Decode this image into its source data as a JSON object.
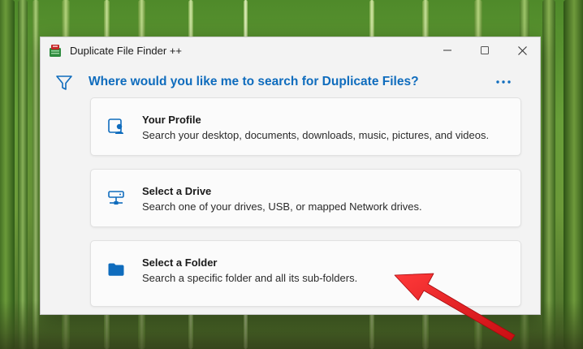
{
  "window": {
    "title": "Duplicate File Finder ++"
  },
  "header": {
    "heading": "Where would you like me to search for Duplicate Files?"
  },
  "options": [
    {
      "title": "Your Profile",
      "description": "Search your desktop, documents, downloads, music, pictures, and videos."
    },
    {
      "title": "Select a Drive",
      "description": "Search one of your drives, USB, or mapped Network drives."
    },
    {
      "title": "Select a Folder",
      "description": "Search a specific folder and all its sub-folders."
    }
  ],
  "colors": {
    "accent": "#0f6cbd",
    "annotation_arrow": "#e8141c"
  },
  "icons": {
    "app": "duplicate-file-finder-app-icon",
    "filter": "filter-icon",
    "more": "more-horizontal-icon",
    "profile": "profile-icon",
    "drive": "network-drive-icon",
    "folder": "folder-icon"
  }
}
